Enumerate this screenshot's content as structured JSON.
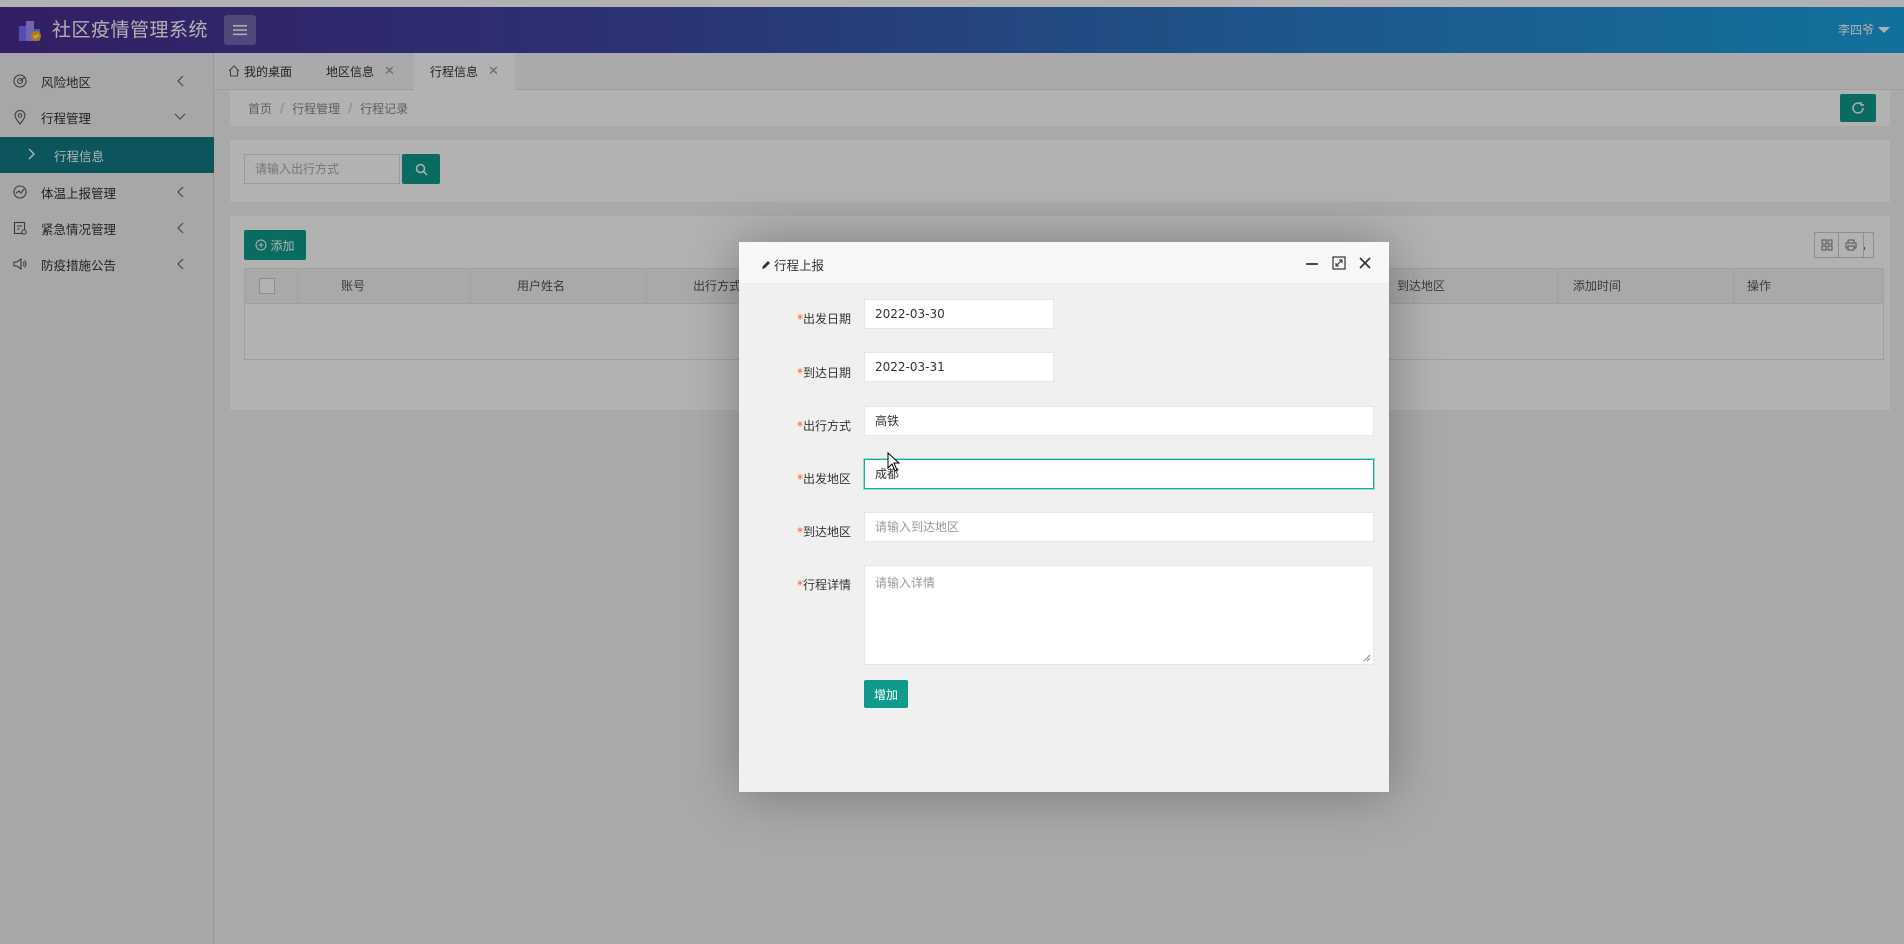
{
  "header": {
    "title": "社区疫情管理系统",
    "user_name": "李四爷",
    "logo_icon": "community-logo-icon",
    "menu_icon": "hamburger-icon"
  },
  "sidebar": {
    "items": [
      {
        "label": "风险地区",
        "icon": "radar-icon",
        "expanded": false
      },
      {
        "label": "行程管理",
        "icon": "location-pin-icon",
        "expanded": true
      },
      {
        "label": "行程信息",
        "icon": "chevron-right-icon",
        "active": true
      },
      {
        "label": "体温上报管理",
        "icon": "chart-icon",
        "expanded": false
      },
      {
        "label": "紧急情况管理",
        "icon": "checklist-icon",
        "expanded": false
      },
      {
        "label": "防疫措施公告",
        "icon": "speaker-icon",
        "expanded": false
      }
    ]
  },
  "tabs": [
    {
      "label": "我的桌面",
      "icon": "home-icon",
      "closable": false
    },
    {
      "label": "地区信息",
      "closable": true
    },
    {
      "label": "行程信息",
      "closable": true,
      "active": true
    }
  ],
  "breadcrumb": [
    "首页",
    "行程管理",
    "行程记录"
  ],
  "search": {
    "placeholder": "请输入出行方式"
  },
  "toolbar": {
    "add_label": "添加"
  },
  "table": {
    "columns": [
      "账号",
      "用户姓名",
      "出行方式",
      "到达地区",
      "添加时间",
      "操作"
    ]
  },
  "modal": {
    "title": "行程上报",
    "fields": [
      {
        "label": "出发日期",
        "value": "2022-03-30",
        "placeholder": ""
      },
      {
        "label": "到达日期",
        "value": "2022-03-31",
        "placeholder": ""
      },
      {
        "label": "出行方式",
        "value": "高铁",
        "placeholder": ""
      },
      {
        "label": "出发地区",
        "value": "成都",
        "placeholder": ""
      },
      {
        "label": "到达地区",
        "value": "",
        "placeholder": "请输入到达地区"
      },
      {
        "label": "行程详情",
        "value": "",
        "placeholder": "请输入详情"
      }
    ],
    "required_mark": "*",
    "submit_label": "增加"
  },
  "colors": {
    "primary": "#0f9a8c",
    "sidebar_active": "#127a85",
    "required": "#ff5722"
  }
}
